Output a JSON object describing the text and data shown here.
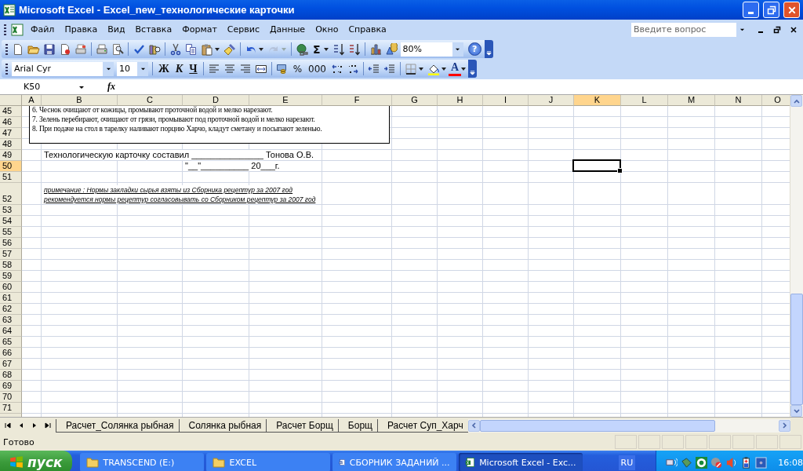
{
  "window": {
    "title": "Microsoft Excel - Excel_new_технологические карточки"
  },
  "menu": [
    {
      "label": "Файл"
    },
    {
      "label": "Правка"
    },
    {
      "label": "Вид"
    },
    {
      "label": "Вставка"
    },
    {
      "label": "Формат"
    },
    {
      "label": "Сервис"
    },
    {
      "label": "Данные"
    },
    {
      "label": "Окно"
    },
    {
      "label": "Справка"
    }
  ],
  "help_search": {
    "placeholder": "Введите вопрос"
  },
  "standard_toolbar": {
    "sum": "Σ",
    "zoom": "80%",
    "help": "?"
  },
  "formatting_toolbar": {
    "font": "Arial Cyr",
    "size": "10",
    "bold": "Ж",
    "italic": "К",
    "underline": "Ч",
    "percent": "%",
    "thousands": "000",
    "font_color": "A"
  },
  "formula_bar": {
    "name_box": "K50",
    "fx": "fx"
  },
  "columns": [
    {
      "label": "A",
      "selected": false
    },
    {
      "label": "B",
      "selected": false
    },
    {
      "label": "C",
      "selected": false
    },
    {
      "label": "D",
      "selected": false
    },
    {
      "label": "E",
      "selected": false
    },
    {
      "label": "F",
      "selected": false
    },
    {
      "label": "G",
      "selected": false
    },
    {
      "label": "H",
      "selected": false
    },
    {
      "label": "I",
      "selected": false
    },
    {
      "label": "J",
      "selected": false
    },
    {
      "label": "K",
      "selected": true
    },
    {
      "label": "L",
      "selected": false
    },
    {
      "label": "M",
      "selected": false
    },
    {
      "label": "N",
      "selected": false
    },
    {
      "label": "O",
      "selected": false
    }
  ],
  "text_box": {
    "lines": [
      "6. Чеснок очищают от кожицы, промывают проточной водой и мелко нарезают.",
      "7. Зелень перебирают, очищают от грязи, промывают под проточной водой и мелко нарезают.",
      "8. При подаче на стол в тарелку наливают порцию Харчо, кладут сметану и посыпают зеленью."
    ]
  },
  "rows": [
    {
      "label": "45",
      "selected": false
    },
    {
      "label": "46",
      "selected": false
    },
    {
      "label": "47",
      "selected": false
    },
    {
      "label": "48",
      "selected": false
    },
    {
      "label": "49",
      "selected": false,
      "b": "Технологическую карточку составил _______________ Тонова О.В."
    },
    {
      "label": "50",
      "selected": true,
      "d": "\"__\"__________ 20___г."
    },
    {
      "label": "51",
      "selected": false
    },
    {
      "label": "52",
      "selected": false,
      "note_lines": [
        "примечание : Нормы закладки сырья взяты из Сборника рецептур за 2007 год",
        "рекомендуется нормы рецептур согласовывать со Сборником рецептур за 2007 год"
      ]
    },
    {
      "label": "53",
      "selected": false
    },
    {
      "label": "54",
      "selected": false
    },
    {
      "label": "55",
      "selected": false
    },
    {
      "label": "56",
      "selected": false
    },
    {
      "label": "57",
      "selected": false
    },
    {
      "label": "58",
      "selected": false
    },
    {
      "label": "59",
      "selected": false
    },
    {
      "label": "60",
      "selected": false
    },
    {
      "label": "61",
      "selected": false
    },
    {
      "label": "62",
      "selected": false
    },
    {
      "label": "63",
      "selected": false
    },
    {
      "label": "64",
      "selected": false
    },
    {
      "label": "65",
      "selected": false
    },
    {
      "label": "66",
      "selected": false
    },
    {
      "label": "67",
      "selected": false
    },
    {
      "label": "68",
      "selected": false
    },
    {
      "label": "69",
      "selected": false
    },
    {
      "label": "70",
      "selected": false
    },
    {
      "label": "71",
      "selected": false
    }
  ],
  "sheet_tabs": [
    {
      "label": "Расчет_Солянка рыбная",
      "selected": false
    },
    {
      "label": "Солянка рыбная",
      "selected": false
    },
    {
      "label": "Расчет Борщ",
      "selected": false
    },
    {
      "label": "Борщ",
      "selected": false
    },
    {
      "label": "Расчет Суп_Харч",
      "selected": false
    }
  ],
  "status_bar": "Готово",
  "taskbar": {
    "start": "пуск",
    "tasks": [
      {
        "label": "TRANSCEND (E:)",
        "kind": "folder",
        "selected": false
      },
      {
        "label": "EXCEL",
        "kind": "folder",
        "selected": false
      },
      {
        "label": "СБОРНИК ЗАДАНИЙ ...",
        "kind": "word",
        "selected": false
      },
      {
        "label": "Microsoft Excel - Exc...",
        "kind": "excel",
        "selected": true
      }
    ],
    "language": "RU",
    "clock": "16:08"
  }
}
